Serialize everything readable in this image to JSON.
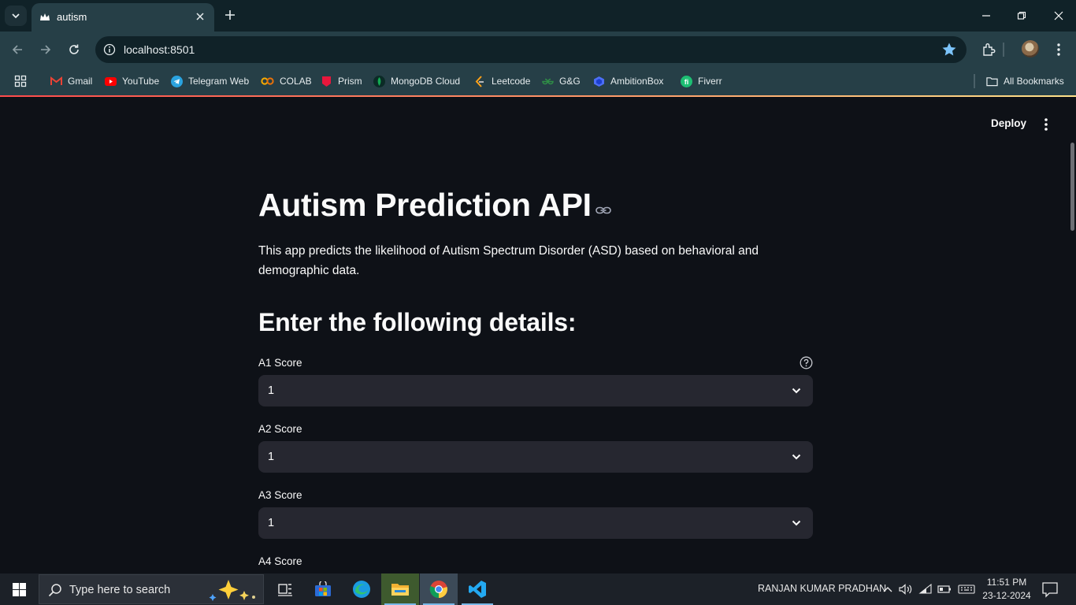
{
  "browser": {
    "tab_title": "autism",
    "url": "localhost:8501",
    "bookmarks": [
      {
        "label": "Gmail",
        "color": "#ea4335"
      },
      {
        "label": "YouTube",
        "color": "#ff0000"
      },
      {
        "label": "Telegram Web",
        "color": "#2aa3df"
      },
      {
        "label": "COLAB",
        "color": "#f9ab00"
      },
      {
        "label": "Prism",
        "color": "#e8173c"
      },
      {
        "label": "MongoDB Cloud",
        "color": "#13aa52"
      },
      {
        "label": "Leetcode",
        "color": "#ffa116"
      },
      {
        "label": "G&G",
        "color": "#2f8d46"
      },
      {
        "label": "AmbitionBox",
        "color": "#4c6ef5"
      },
      {
        "label": "Fiverr",
        "color": "#1dbf73"
      }
    ],
    "all_bookmarks": "All Bookmarks"
  },
  "app": {
    "deploy_label": "Deploy",
    "title": "Autism Prediction API",
    "description": "This app predicts the likelihood of Autism Spectrum Disorder (ASD) based on behavioral and demographic data.",
    "section_heading": "Enter the following details:",
    "fields": [
      {
        "label": "A1 Score",
        "value": "1",
        "has_help": true
      },
      {
        "label": "A2 Score",
        "value": "1"
      },
      {
        "label": "A3 Score",
        "value": "1"
      },
      {
        "label": "A4 Score"
      }
    ]
  },
  "taskbar": {
    "search_placeholder": "Type here to search",
    "user": "RANJAN KUMAR PRADHAN",
    "time": "11:51 PM",
    "date": "23-12-2024"
  },
  "colors": {
    "accent_streamlit": "#ff4b4b",
    "page_bg": "#0e1117",
    "select_bg": "#262730",
    "chrome_bg": "#263f47"
  }
}
